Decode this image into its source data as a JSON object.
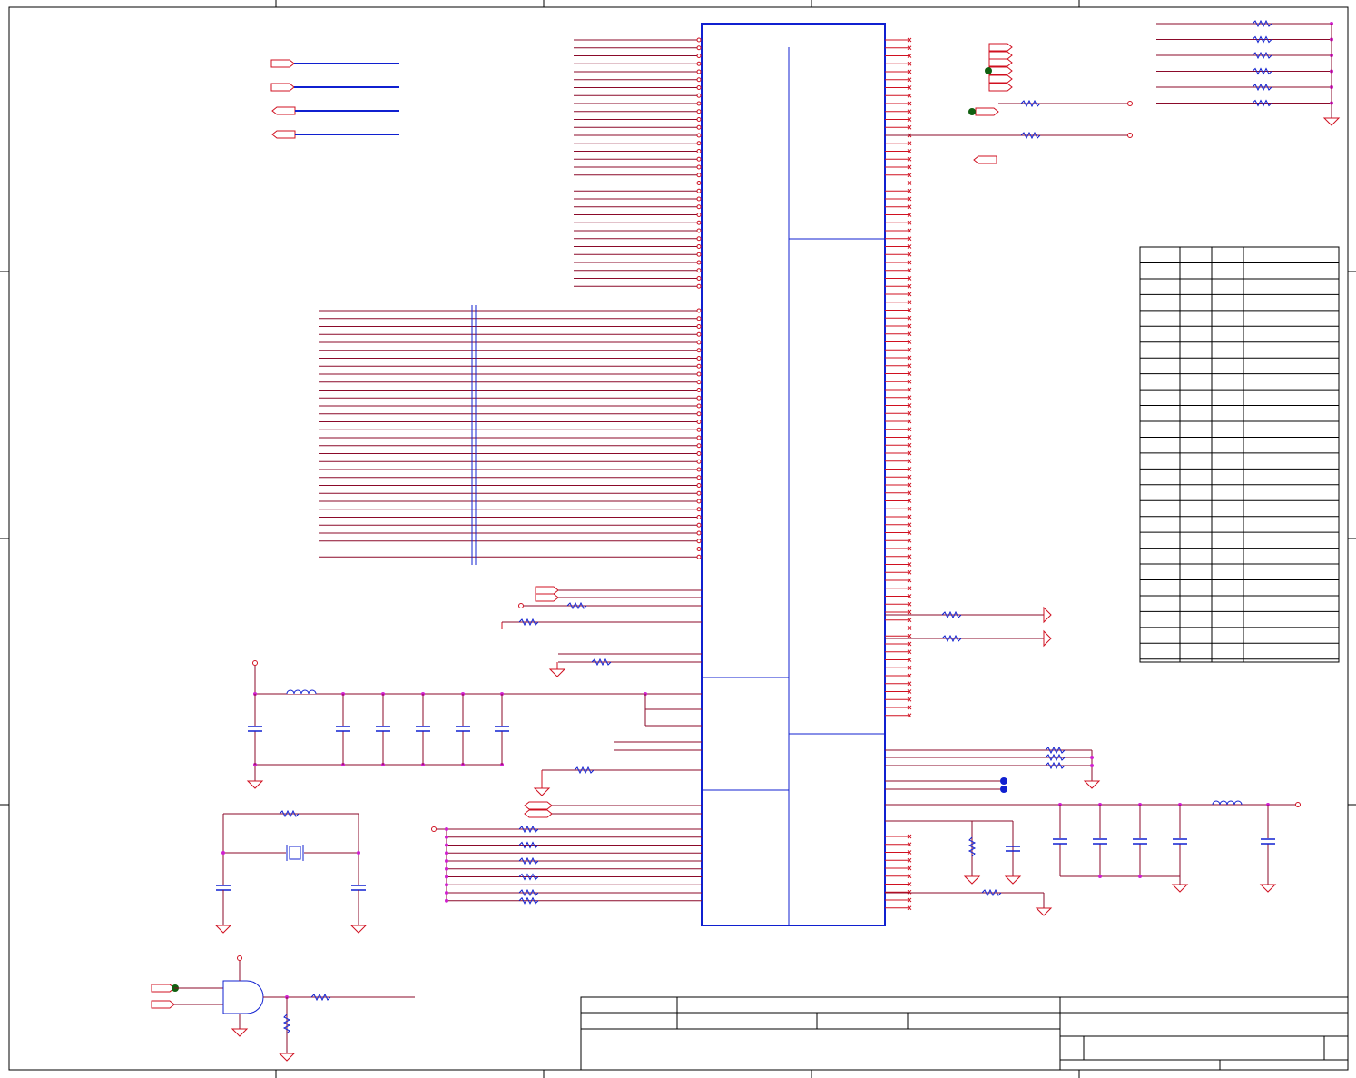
{
  "sheet": {
    "title": "",
    "colors": {
      "wire": "#8b0a2a",
      "pin": "#d01020",
      "component": "#1020d0",
      "junction": "#d020d0",
      "marker": "#106010"
    },
    "icons": [
      "ground-icon",
      "power-port-icon",
      "resistor-icon",
      "capacitor-icon",
      "inductor-icon",
      "crystal-icon",
      "and-gate-icon",
      "offsheet-connector-icon",
      "no-connect-icon"
    ]
  }
}
